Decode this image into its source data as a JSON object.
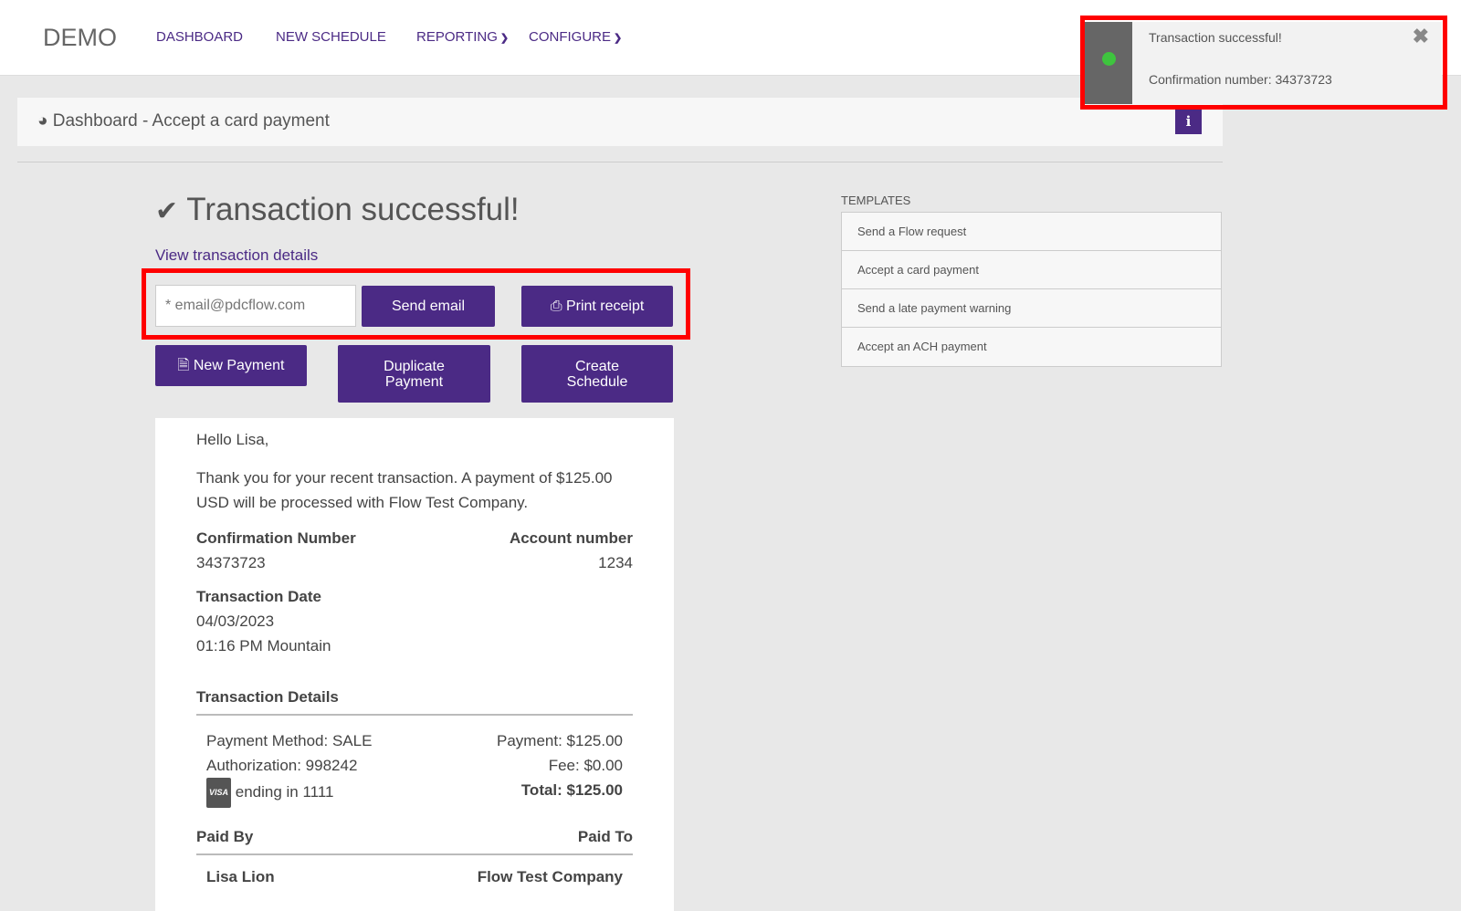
{
  "nav": {
    "logo": "DEMO",
    "items": [
      "DASHBOARD",
      "NEW SCHEDULE",
      "REPORTING",
      "CONFIGURE"
    ]
  },
  "breadcrumb": "Dashboard - Accept a card payment",
  "info_label": "i",
  "main": {
    "title": "Transaction successful!",
    "view_details": "View transaction details",
    "email_placeholder": "* email@pdcflow.com",
    "send_email": "Send email",
    "print_receipt": "Print receipt",
    "new_payment": "New Payment",
    "duplicate_payment": "Duplicate Payment",
    "create_schedule": "Create Schedule"
  },
  "receipt": {
    "greeting": "Hello Lisa,",
    "message": "Thank you for your recent transaction. A payment of $125.00 USD will be processed with Flow Test Company.",
    "conf_label": "Confirmation Number",
    "conf_value": "34373723",
    "acct_label": "Account number",
    "acct_value": "1234",
    "date_label": "Transaction Date",
    "date": "04/03/2023",
    "time": "01:16 PM Mountain",
    "details_label": "Transaction Details",
    "method": "Payment Method: SALE",
    "auth": "Authorization: 998242",
    "card_brand": "VISA",
    "card": "ending in 1111",
    "payment": "Payment: $125.00",
    "fee": "Fee: $0.00",
    "total": "Total: $125.00",
    "paid_by_label": "Paid By",
    "paid_to_label": "Paid To",
    "paid_by": "Lisa Lion",
    "paid_to": "Flow Test Company"
  },
  "templates": {
    "label": "TEMPLATES",
    "items": [
      "Send a Flow request",
      "Accept a card payment",
      "Send a late payment warning",
      "Accept an ACH payment"
    ]
  },
  "toast": {
    "title": "Transaction successful!",
    "message": "Confirmation number: 34373723"
  }
}
